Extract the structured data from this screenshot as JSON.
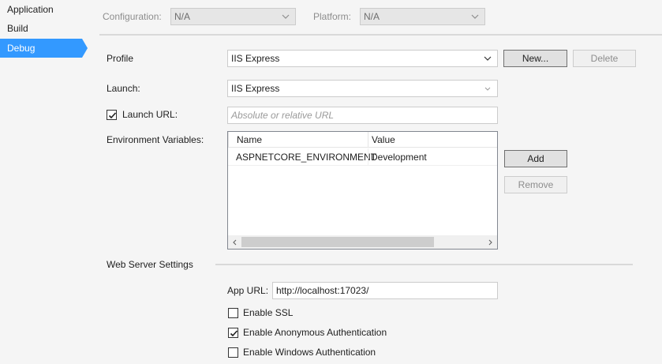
{
  "nav": {
    "items": [
      {
        "label": "Application",
        "active": false
      },
      {
        "label": "Build",
        "active": false
      },
      {
        "label": "Debug",
        "active": true
      }
    ]
  },
  "config": {
    "configuration_label": "Configuration:",
    "configuration_value": "N/A",
    "platform_label": "Platform:",
    "platform_value": "N/A"
  },
  "profile": {
    "label": "Profile",
    "value": "IIS Express",
    "new_button": "New...",
    "delete_button": "Delete"
  },
  "launch": {
    "label": "Launch:",
    "value": "IIS Express"
  },
  "launch_url": {
    "label": "Launch URL:",
    "checked": true,
    "placeholder": "Absolute or relative URL"
  },
  "env": {
    "label": "Environment Variables:",
    "columns": [
      "Name",
      "Value"
    ],
    "rows": [
      {
        "name": "ASPNETCORE_ENVIRONMENT",
        "value": "Development"
      }
    ],
    "add_button": "Add",
    "remove_button": "Remove"
  },
  "web_server": {
    "section_label": "Web Server Settings",
    "app_url_label": "App URL:",
    "app_url_value": "http://localhost:17023/",
    "enable_ssl_label": "Enable SSL",
    "enable_ssl_checked": false,
    "anon_auth_label": "Enable Anonymous Authentication",
    "anon_auth_checked": true,
    "windows_auth_label": "Enable Windows Authentication",
    "windows_auth_checked": false
  },
  "colors": {
    "accent": "#3399ff",
    "background": "#f5f5f5"
  },
  "icons": {
    "dropdown": "chevron-down-icon",
    "check": "check-icon",
    "scroll_left": "chevron-left-icon",
    "scroll_right": "chevron-right-icon"
  }
}
